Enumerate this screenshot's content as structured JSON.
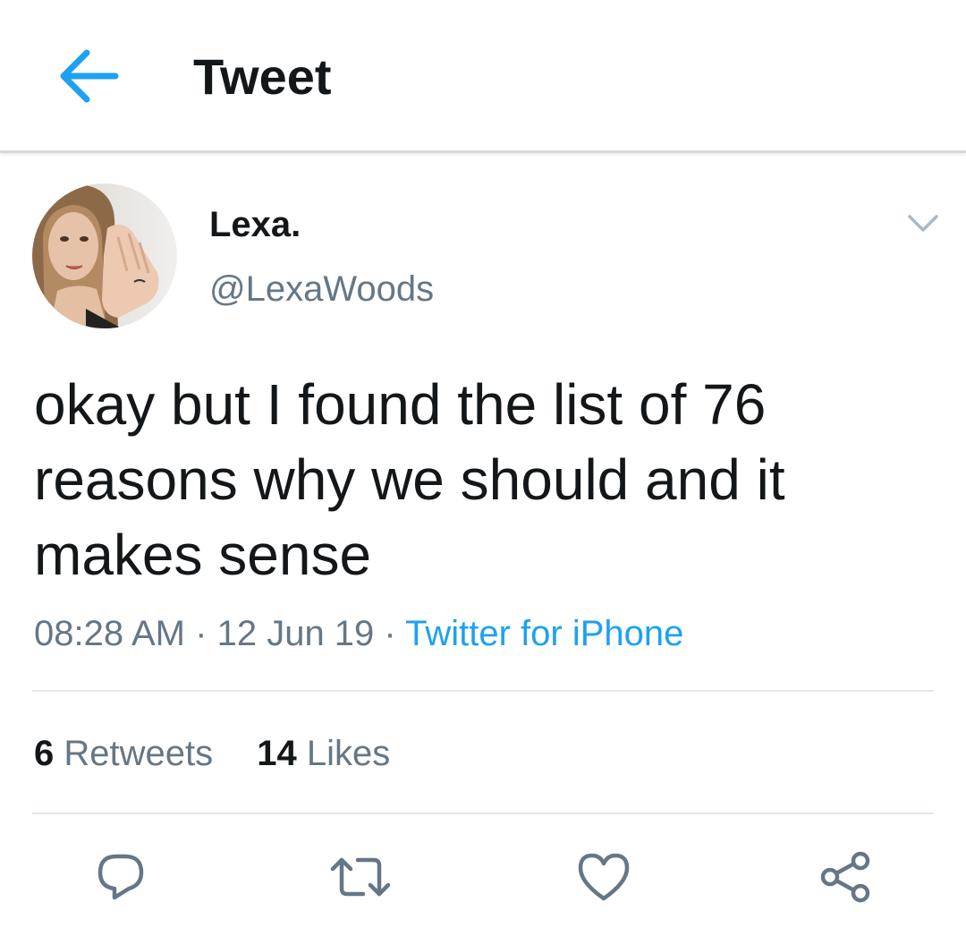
{
  "header": {
    "back_icon": "arrow-left-icon",
    "title": "Tweet",
    "accent_color": "#1da1f2"
  },
  "author": {
    "display_name": "Lexa.",
    "username": "@LexaWoods",
    "avatar": "profile-photo"
  },
  "tweet": {
    "text": "okay but I found the list of 76 reasons why we should and it makes sense",
    "time": "08:28 AM",
    "separator": "·",
    "date": "12 Jun 19",
    "source": "Twitter for iPhone"
  },
  "stats": {
    "retweets_count": "6",
    "retweets_label": "Retweets",
    "likes_count": "14",
    "likes_label": "Likes"
  },
  "actions": {
    "reply_icon": "reply-icon",
    "retweet_icon": "retweet-icon",
    "like_icon": "heart-icon",
    "share_icon": "share-icon"
  },
  "colors": {
    "text_primary": "#14171a",
    "text_secondary": "#657786",
    "link": "#1da1f2",
    "divider": "#e1e8ed"
  }
}
